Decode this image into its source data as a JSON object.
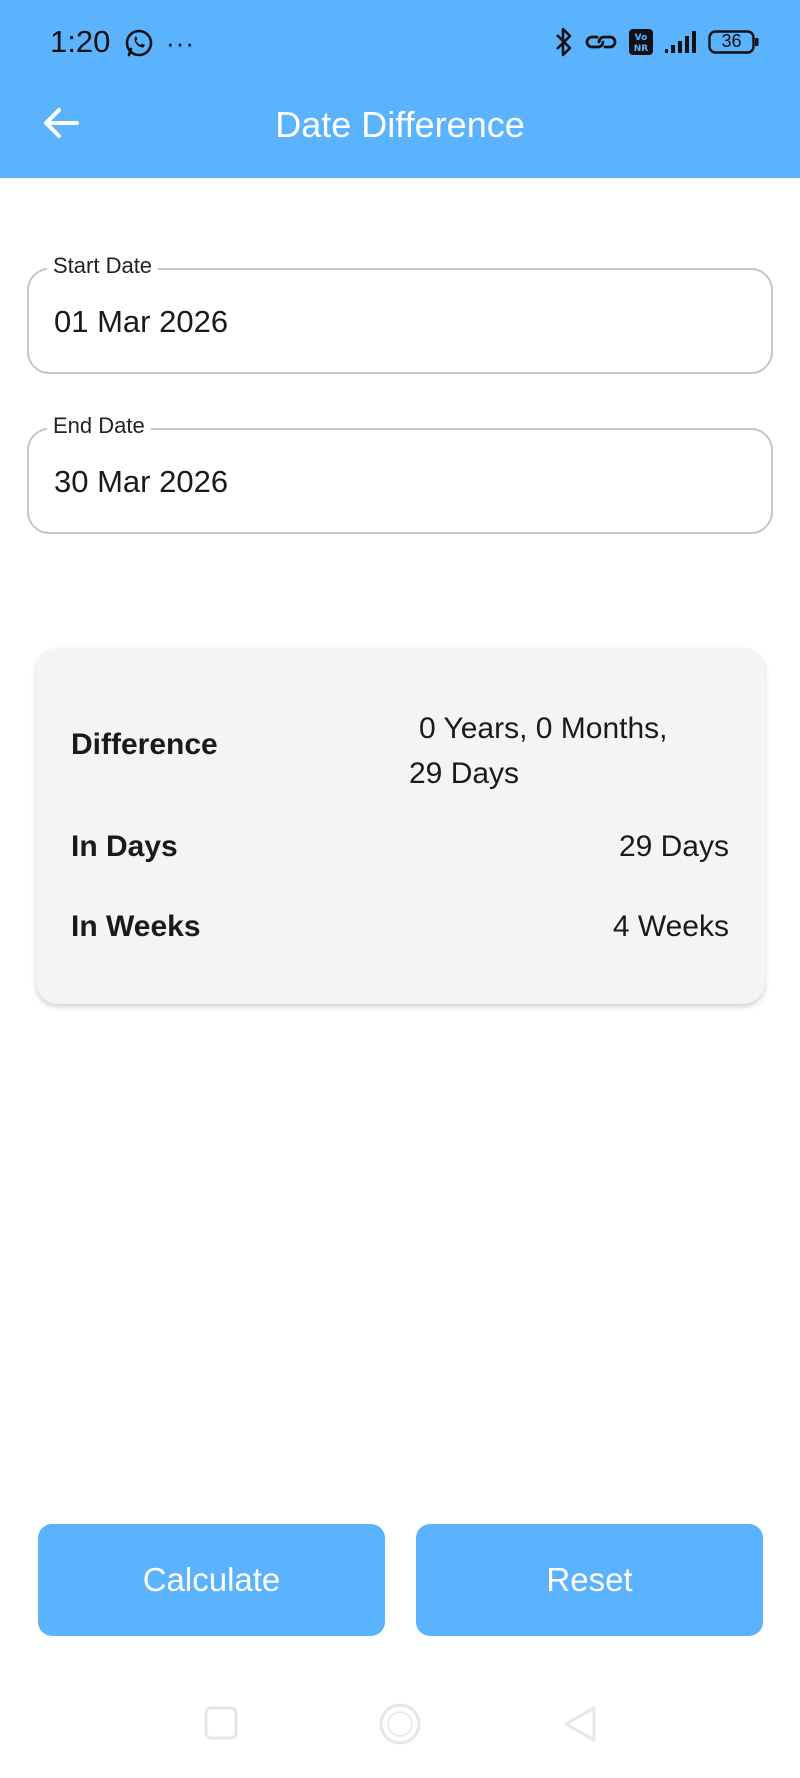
{
  "status_bar": {
    "time": "1:20",
    "more": "···",
    "battery": "36",
    "icons": [
      "whatsapp-icon",
      "bluetooth-icon",
      "link-icon",
      "volte-icon",
      "signal-icon",
      "battery-icon"
    ]
  },
  "header": {
    "title": "Date Difference",
    "back_icon": "arrow-left-icon",
    "color": "#5bb3fd"
  },
  "form": {
    "start_date": {
      "label": "Start Date",
      "value": "01 Mar 2026"
    },
    "end_date": {
      "label": "End Date",
      "value": "30 Mar 2026"
    }
  },
  "result": {
    "difference": {
      "label": "Difference",
      "value_line1": "0 Years, 0 Months,",
      "value_line2": "29 Days"
    },
    "in_days": {
      "label": "In Days",
      "value": "29 Days"
    },
    "in_weeks": {
      "label": "In Weeks",
      "value": "4 Weeks"
    }
  },
  "actions": {
    "calculate_label": "Calculate",
    "reset_label": "Reset"
  },
  "nav_bar": {
    "icons": [
      "recent-apps-icon",
      "home-icon",
      "back-triangle-icon"
    ]
  }
}
